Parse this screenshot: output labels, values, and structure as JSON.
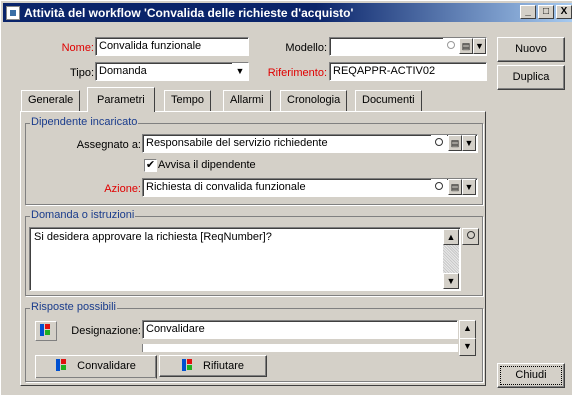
{
  "window": {
    "title": "Attività del workflow 'Convalida delle richieste d'acquisto'",
    "min": "_",
    "max": "□",
    "close": "X"
  },
  "header": {
    "name_label": "Nome:",
    "name_value": "Convalida funzionale",
    "model_label": "Modello:",
    "model_value": "",
    "type_label": "Tipo:",
    "type_value": "Domanda",
    "ref_label": "Riferimento:",
    "ref_value": "REQAPPR-ACTIV02"
  },
  "side_buttons": {
    "new": "Nuovo",
    "duplicate": "Duplica",
    "close": "Chiudi"
  },
  "tabs": [
    "Generale",
    "Parametri",
    "Tempo",
    "Allarmi",
    "Cronologia",
    "Documenti"
  ],
  "assignee": {
    "group_title": "Dipendente incaricato",
    "assigned_label": "Assegnato a:",
    "assigned_value": "Responsabile del servizio richiedente",
    "notify_label": "Avvisa il dipendente",
    "notify_checked": true,
    "action_label": "Azione:",
    "action_value": "Richiesta di convalida funzionale"
  },
  "question": {
    "group_title": "Domanda o istruzioni",
    "text": "Si desidera approvare la richiesta [ReqNumber]?"
  },
  "answers": {
    "group_title": "Risposte possibili",
    "designation_label": "Designazione:",
    "designation_value": "Convalidare",
    "buttons": [
      "Convalidare",
      "Rifiutare"
    ]
  },
  "colors": {
    "title_start": "#0a246a",
    "title_end": "#a6caf0",
    "required": "#e00000",
    "group_title": "#1a3c8c"
  }
}
